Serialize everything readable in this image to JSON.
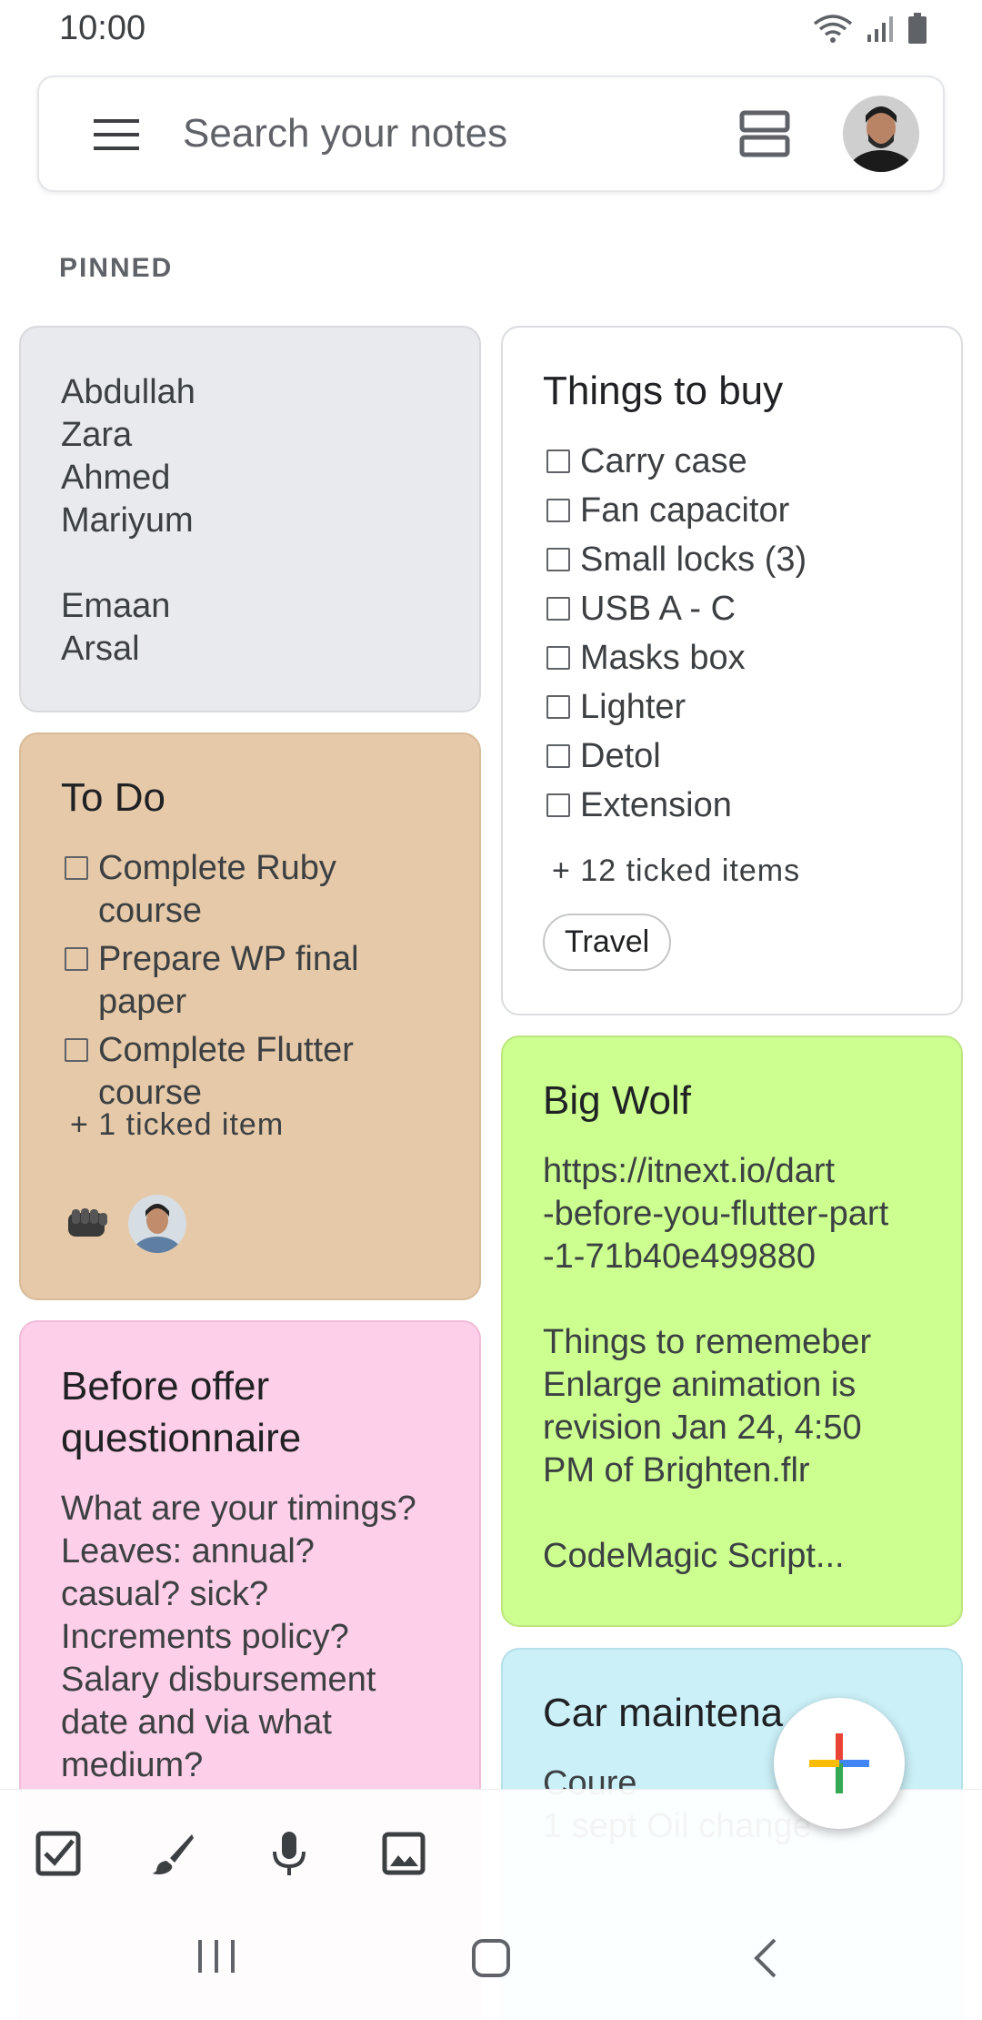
{
  "status": {
    "time": "10:00"
  },
  "search": {
    "placeholder": "Search your notes"
  },
  "section": {
    "pinned": "PINNED"
  },
  "notes": {
    "names": {
      "body": "Abdullah\nZara\nAhmed\nMariyum\n\nEmaan\nArsal"
    },
    "things_to_buy": {
      "title": "Things to buy",
      "items": [
        "Carry case",
        "Fan capacitor",
        "Small locks (3)",
        "USB A - C",
        "Masks box",
        "Lighter",
        "Detol",
        "Extension"
      ],
      "ticked": "+ 12 ticked items",
      "label": "Travel"
    },
    "todo": {
      "title": "To Do",
      "items": [
        "Complete Ruby\ncourse",
        "Prepare WP final\npaper",
        "Complete Flutter\ncourse"
      ],
      "ticked": "+ 1 ticked item"
    },
    "big_wolf": {
      "title": "Big Wolf",
      "body": "https://itnext.io/dart\n-before-you-flutter-part\n-1-71b40e499880\n\nThings to rememeber\nEnlarge animation is\nrevision Jan 24, 4:50\nPM of Brighten.flr\n\nCodeMagic Script..."
    },
    "offer": {
      "title": "Before offer\nquestionnaire",
      "body": "What are your timings?\nLeaves: annual?\ncasual? sick?\nIncrements policy?\nSalary disbursement\ndate and via what\nmedium?"
    },
    "car": {
      "title": "Car maintena",
      "body": "Coure\n1 sept Oil change"
    }
  },
  "colors": {
    "grey": "#e8eaed",
    "brown": "#e6c9a8",
    "green": "#ccff90",
    "pink": "#fdcfe8",
    "teal": "#cbf0f8"
  },
  "toolbar": [
    "checkbox-icon",
    "brush-icon",
    "mic-icon",
    "image-icon"
  ],
  "fab": "plus-icon"
}
